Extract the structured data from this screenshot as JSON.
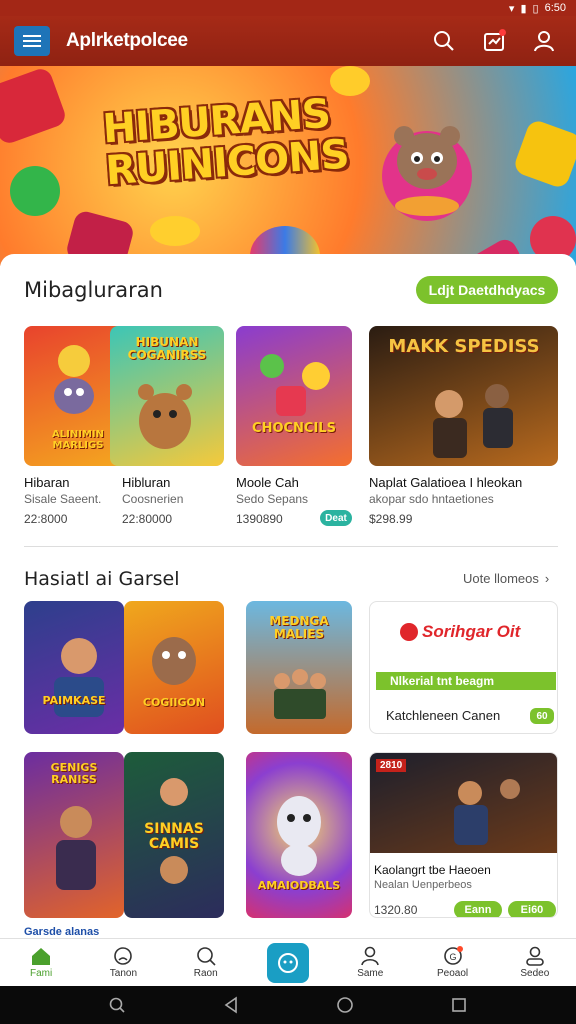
{
  "status": {
    "time": "6:50"
  },
  "appbar": {
    "title": "Aplrketpolcee",
    "menu_icon": "hamburger-icon",
    "search_icon": "search-icon",
    "notification_icon": "notification-icon",
    "profile_icon": "profile-icon"
  },
  "hero": {
    "title_line1": "HIBURANS",
    "title_line2": "RUINICONS"
  },
  "section1": {
    "title": "Mibagluraran",
    "action_label": "Ldjt Daetdhdyacs",
    "cards": [
      {
        "art": "ALINIMIN MARLIGS",
        "name": "Hibaran",
        "sub": "Sisale Saeent.",
        "price": "22:8000"
      },
      {
        "art": "HIBUNAN COGANIRSS",
        "name": "Hibluran",
        "sub": "Coosnerien",
        "price": "22:80000"
      },
      {
        "art": "CHOCNCILS",
        "name": "Moole Cah",
        "sub": "Sedo Sepans",
        "price": "1390890",
        "badge": "Deat"
      },
      {
        "art": "MAKK SPEDISS",
        "name": "Naplat Galatioea I hleokan",
        "sub": "akopar sdo hntaetiones",
        "price": "$298.99"
      }
    ]
  },
  "section2": {
    "title": "Hasiatl ai Garsel",
    "see_more": "Uote llomeos",
    "tiles": [
      {
        "art": "PAIMKASE"
      },
      {
        "art": "COGIIGON"
      },
      {
        "art": "MEDNGA MALIES"
      },
      {
        "art": "GENIGS RANISS"
      },
      {
        "art": "SINNAS CAMIS"
      },
      {
        "art": "AMAIODBALS"
      }
    ],
    "promo1": {
      "brand": "Sorihgar Oit",
      "banner": "Nlkerial tnt beagm",
      "name": "Katchleneen Canen",
      "badge": "60"
    },
    "promo2": {
      "tag": "2810",
      "name": "Kaolangrt tbe Haeoen",
      "sub": "Nealan Uenperbeos",
      "price": "1320.80",
      "btn1": "Eann",
      "btn2": "Ei60"
    }
  },
  "partial_label": "Garsde alanas",
  "nav": [
    {
      "label": "Fami",
      "icon": "home-icon"
    },
    {
      "label": "Tanon",
      "icon": "sad-face-icon"
    },
    {
      "label": "Raon",
      "icon": "search-icon"
    },
    {
      "label": "",
      "icon": "chat-icon"
    },
    {
      "label": "Same",
      "icon": "user-icon"
    },
    {
      "label": "Peoaol",
      "icon": "badge-icon"
    },
    {
      "label": "Sedeo",
      "icon": "account-icon"
    }
  ],
  "colors": {
    "appbar": "#a32716",
    "accent_green": "#7cc22c",
    "teal": "#2bb3a0",
    "menu_blue": "#1e74b8",
    "nav_active": "#4aa02c"
  }
}
